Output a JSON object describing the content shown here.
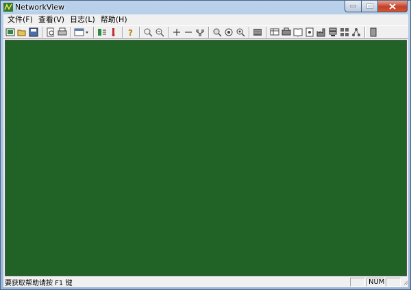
{
  "window": {
    "title": "NetworkView",
    "accent": "#216327"
  },
  "menubar": {
    "items": [
      {
        "label": "文件(F)"
      },
      {
        "label": "查看(V)"
      },
      {
        "label": "日志(L)"
      },
      {
        "label": "帮助(H)"
      }
    ]
  },
  "toolbar": {
    "icons": [
      "new-map-icon",
      "open-folder-icon",
      "save-icon",
      "print-preview-icon",
      "print-icon",
      "view-dropdown-icon",
      "node-properties-icon",
      "alarm-icon",
      "help-icon",
      "zoom-select-icon",
      "zoom-fit-icon",
      "add-node-icon",
      "remove-node-icon",
      "network-scan-icon",
      "find-icon",
      "ping-icon",
      "trace-route-icon",
      "list-view-icon",
      "hosts-icon",
      "printer-device-icon",
      "book-icon",
      "router-icon",
      "factory-icon",
      "server-icon",
      "cluster-icon",
      "network-link-icon",
      "log-icon"
    ]
  },
  "statusbar": {
    "hint": "要获取帮助请按 F1 键",
    "panel1": "",
    "num": "NUM",
    "panel3": ""
  }
}
